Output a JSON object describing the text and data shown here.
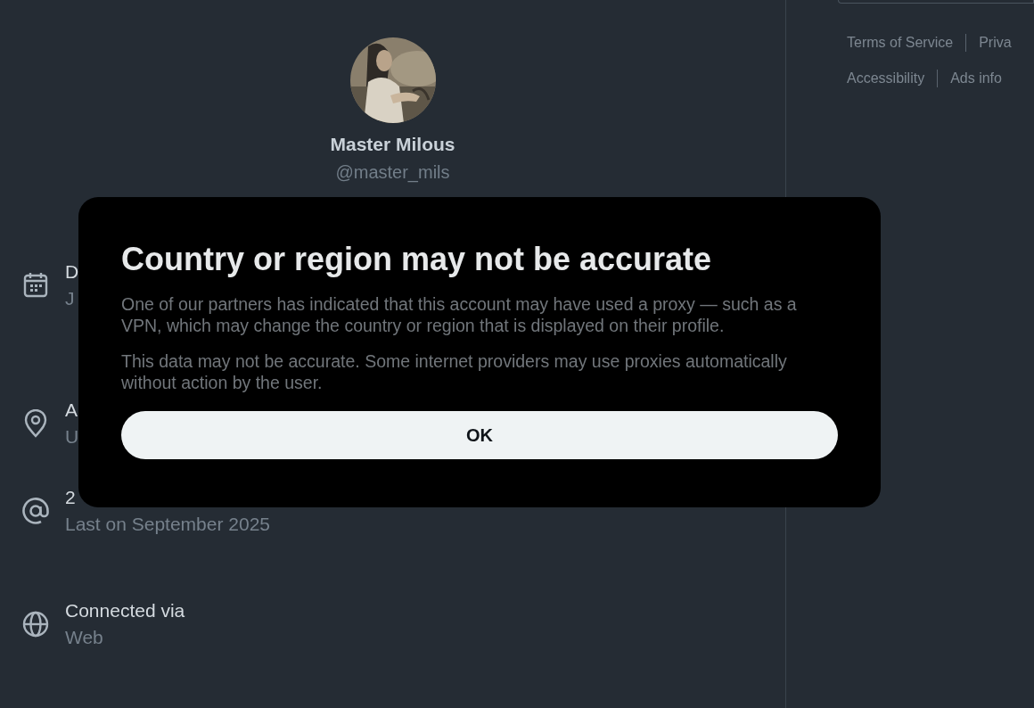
{
  "profile": {
    "name": "Master Milous",
    "handle": "@master_mils"
  },
  "details": [
    {
      "label": "D",
      "value": "J"
    },
    {
      "label": "A",
      "value": "U"
    },
    {
      "label": "2",
      "value": "Last on September 2025"
    },
    {
      "label": "Connected via",
      "value": "Web"
    }
  ],
  "footer_links": [
    [
      "Terms of Service",
      "Priva"
    ],
    [
      "Accessibility",
      "Ads info"
    ]
  ],
  "dialog": {
    "title": "Country or region may not be accurate",
    "paragraphs": [
      "One of our partners has indicated that this account may have used a proxy — such as a VPN, which may change the country or region that is displayed on their profile.",
      "This data may not be accurate. Some internet providers may use proxies automatically without action by the user."
    ],
    "button": "OK"
  }
}
